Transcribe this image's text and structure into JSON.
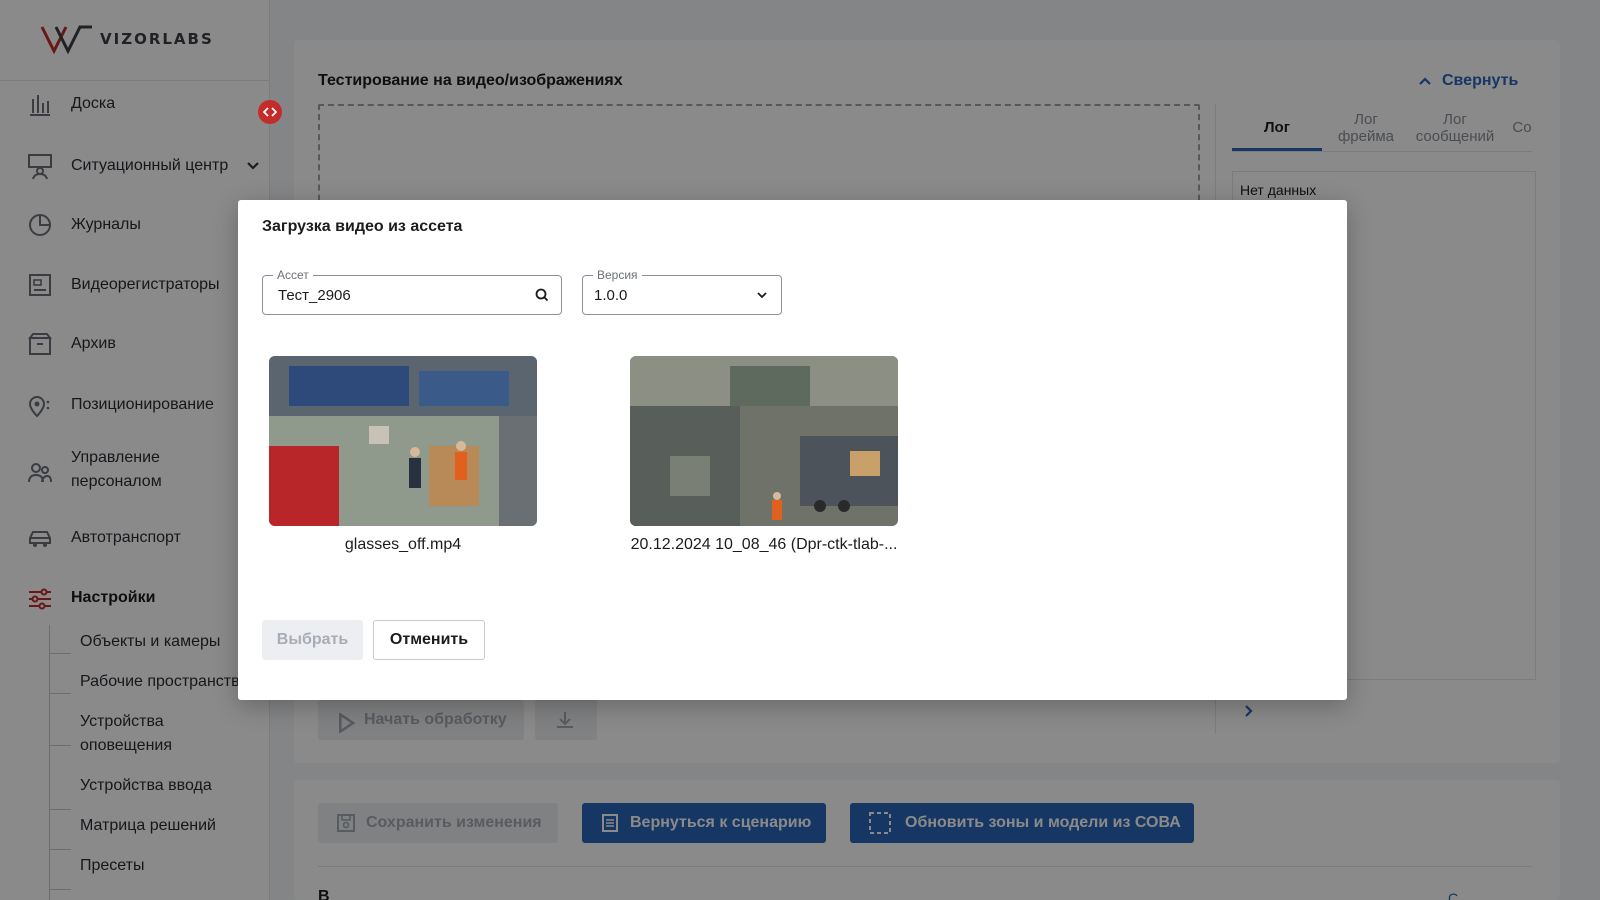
{
  "app": {
    "logo_text": "VIZORLABS"
  },
  "sidebar": {
    "items": [
      {
        "label": "Доска",
        "icon": "chart-bars-icon"
      },
      {
        "label": "Ситуационный центр",
        "icon": "monitor-person-icon"
      },
      {
        "label": "Журналы",
        "icon": "pie-chart-icon"
      },
      {
        "label": "Видеорегистраторы",
        "icon": "video-recorder-icon"
      },
      {
        "label": "Архив",
        "icon": "archive-box-icon"
      },
      {
        "label": "Позиционирование",
        "icon": "location-pin-icon"
      },
      {
        "label": "Управление персоналом",
        "icon": "people-icon"
      },
      {
        "label": "Автотранспорт",
        "icon": "car-icon"
      },
      {
        "label": "Настройки",
        "icon": "sliders-icon"
      }
    ],
    "sub_items": [
      "Объекты и камеры",
      "Рабочие пространства",
      "Устройства оповещения",
      "Устройства ввода",
      "Матрица решений",
      "Пресеты"
    ],
    "accent_color": "#c62b2b"
  },
  "main": {
    "title": "Тестирование на видео/изображениях",
    "collapse_label": "Свернуть",
    "tabs": [
      "Лог",
      "Лог фрейма",
      "Лог сообщений",
      "Со"
    ],
    "log_empty": "Нет данных",
    "start_label": "Начать обработку",
    "save_label": "Сохранить изменения",
    "back_label": "Вернуться к сценарию",
    "update_label": "Обновить зоны и модели из СОВА",
    "bottom_title": "В",
    "bottom_right": "С",
    "accent_color": "#2a64b8"
  },
  "modal": {
    "title": "Загрузка видео из ассета",
    "asset_legend": "Ассет",
    "asset_value": "Тест_2906",
    "version_legend": "Версия",
    "version_value": "1.0.0",
    "videos": [
      {
        "caption": "glasses_off.mp4"
      },
      {
        "caption": "20.12.2024 10_08_46 (Dpr-ctk-tlab-..."
      }
    ],
    "select_label": "Выбрать",
    "cancel_label": "Отменить"
  }
}
